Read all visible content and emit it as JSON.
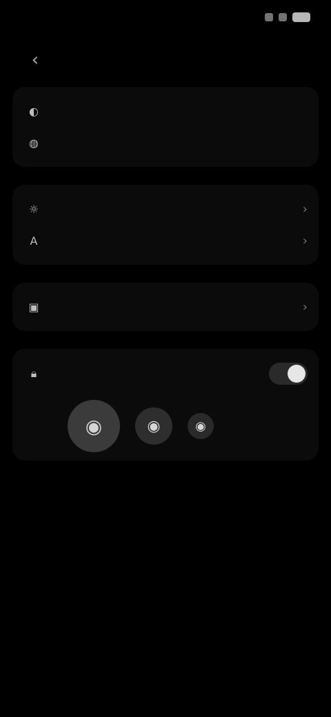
{
  "status": {
    "time": "",
    "icons": [
      "wifi-icon",
      "signal-icon",
      "battery-icon"
    ]
  },
  "header": {
    "title": ""
  },
  "sections": {
    "top_list": [
      {
        "icon": "contrast-icon",
        "title": "",
        "subtitle": ""
      },
      {
        "icon": "palette-icon",
        "title": "",
        "subtitle": ""
      }
    ],
    "display_header": "",
    "display_items": [
      {
        "icon": "sun-icon",
        "title": "",
        "value": ""
      },
      {
        "icon": "text-size-icon",
        "title": "",
        "value": ""
      }
    ],
    "wallpaper_header": "",
    "wallpaper_item": {
      "icon": "image-icon",
      "title": "",
      "subtitle": "",
      "value": ""
    },
    "other_header": "",
    "other_item": {
      "icon": "lock-icon",
      "title": "",
      "subtitle": ""
    },
    "app_icons": [
      "app-icon-1",
      "app-icon-2",
      "app-icon-3"
    ]
  }
}
